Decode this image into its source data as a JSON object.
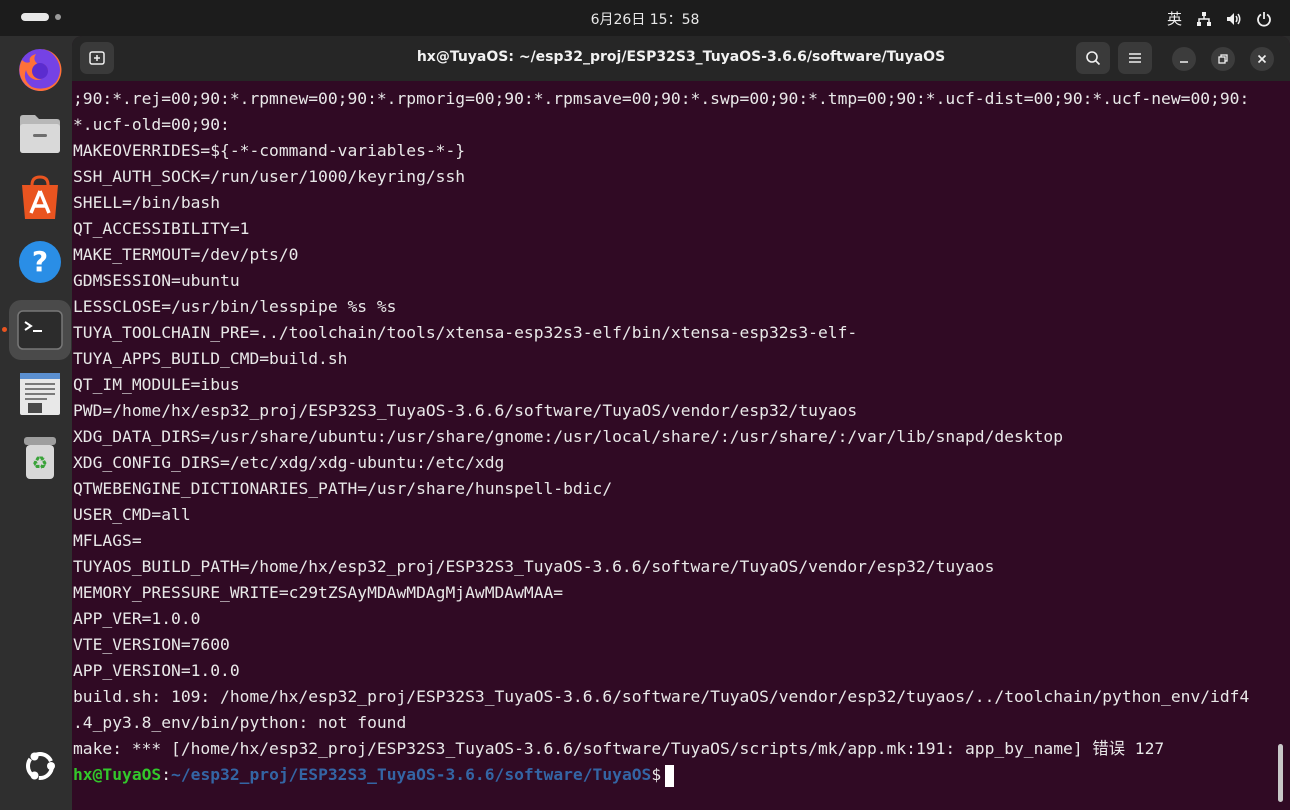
{
  "topbar": {
    "clock": "6月26日 15：58",
    "input_method": "英"
  },
  "dock": {
    "items": [
      {
        "name": "firefox",
        "icon": "firefox-icon"
      },
      {
        "name": "files",
        "icon": "files-icon"
      },
      {
        "name": "app-center",
        "icon": "app-center-icon"
      },
      {
        "name": "help",
        "icon": "help-icon"
      },
      {
        "name": "terminal",
        "icon": "terminal-icon",
        "active": true
      },
      {
        "name": "text-editor",
        "icon": "text-editor-icon"
      },
      {
        "name": "trash",
        "icon": "trash-icon"
      },
      {
        "name": "show-apps",
        "icon": "ubuntu-logo-icon"
      }
    ]
  },
  "window": {
    "title": "hx@TuyaOS: ~/esp32_proj/ESP32S3_TuyaOS-3.6.6/software/TuyaOS"
  },
  "terminal": {
    "lines": [
      ";90:*.rej=00;90:*.rpmnew=00;90:*.rpmorig=00;90:*.rpmsave=00;90:*.swp=00;90:*.tmp=00;90:*.ucf-dist=00;90:*.ucf-new=00;90:",
      "*.ucf-old=00;90:",
      "MAKEOVERRIDES=${-*-command-variables-*-}",
      "SSH_AUTH_SOCK=/run/user/1000/keyring/ssh",
      "SHELL=/bin/bash",
      "QT_ACCESSIBILITY=1",
      "MAKE_TERMOUT=/dev/pts/0",
      "GDMSESSION=ubuntu",
      "LESSCLOSE=/usr/bin/lesspipe %s %s",
      "TUYA_TOOLCHAIN_PRE=../toolchain/tools/xtensa-esp32s3-elf/bin/xtensa-esp32s3-elf-",
      "TUYA_APPS_BUILD_CMD=build.sh",
      "QT_IM_MODULE=ibus",
      "PWD=/home/hx/esp32_proj/ESP32S3_TuyaOS-3.6.6/software/TuyaOS/vendor/esp32/tuyaos",
      "XDG_DATA_DIRS=/usr/share/ubuntu:/usr/share/gnome:/usr/local/share/:/usr/share/:/var/lib/snapd/desktop",
      "XDG_CONFIG_DIRS=/etc/xdg/xdg-ubuntu:/etc/xdg",
      "QTWEBENGINE_DICTIONARIES_PATH=/usr/share/hunspell-bdic/",
      "USER_CMD=all",
      "MFLAGS=",
      "TUYAOS_BUILD_PATH=/home/hx/esp32_proj/ESP32S3_TuyaOS-3.6.6/software/TuyaOS/vendor/esp32/tuyaos",
      "MEMORY_PRESSURE_WRITE=c29tZSAyMDAwMDAgMjAwMDAwMAA=",
      "APP_VER=1.0.0",
      "VTE_VERSION=7600",
      "APP_VERSION=1.0.0",
      "build.sh: 109: /home/hx/esp32_proj/ESP32S3_TuyaOS-3.6.6/software/TuyaOS/vendor/esp32/tuyaos/../toolchain/python_env/idf4",
      ".4_py3.8_env/bin/python: not found",
      "make: *** [/home/hx/esp32_proj/ESP32S3_TuyaOS-3.6.6/software/TuyaOS/scripts/mk/app.mk:191: app_by_name] 错误 127"
    ],
    "prompt_user": "hx@TuyaOS",
    "prompt_sep": ":",
    "prompt_path": "~/esp32_proj/ESP32S3_TuyaOS-3.6.6/software/TuyaOS",
    "prompt_symbol": "$"
  },
  "colors": {
    "terminal_bg": "#300a24",
    "prompt_user": "#33c72b",
    "prompt_path": "#3465a4",
    "accent": "#e95420"
  }
}
